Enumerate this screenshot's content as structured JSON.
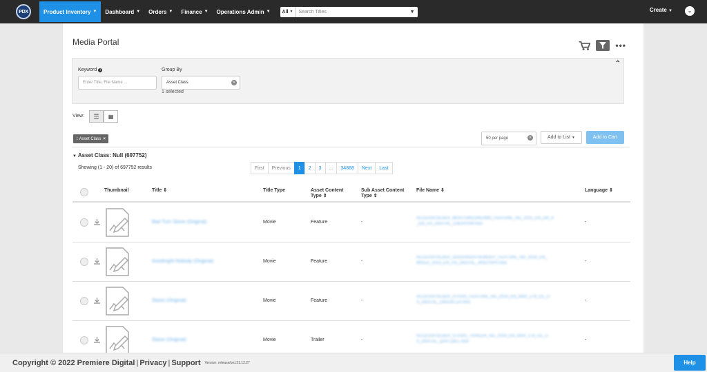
{
  "nav": {
    "logo": "PDX",
    "items": [
      {
        "label": "Product Inventory"
      },
      {
        "label": "Dashboard"
      },
      {
        "label": "Orders"
      },
      {
        "label": "Finance"
      },
      {
        "label": "Operations Admin"
      }
    ],
    "search_scope": "All",
    "search_placeholder": "Search Titles",
    "create_label": "Create"
  },
  "page": {
    "title": "Media Portal",
    "keyword_label": "Keyword",
    "keyword_placeholder": "Enter Title, File Name ...",
    "group_by_label": "Group By",
    "group_by_value": "Asset Class",
    "group_by_selected": "1 selected",
    "view_label": "View:",
    "filter_chip": ":: Asset Class",
    "per_page": "50 per page",
    "add_to_list": "Add to List",
    "add_to_cart": "Add to Cart",
    "group_title": "Asset Class: Null (697752)",
    "showing": "Showing (1 - 20) of 697752 results"
  },
  "pager": [
    "First",
    "Previous",
    "1",
    "2",
    "3",
    "...",
    "34888",
    "Next",
    "Last"
  ],
  "table": {
    "headers": {
      "thumbnail": "Thumbnail",
      "title": "Title",
      "title_type": "Title Type",
      "asset_content_type": "Asset Content Type",
      "sub_asset_content_type": "Sub Asset Content Type",
      "file_name": "File Name",
      "language": "Language"
    },
    "rows": [
      {
        "title": "Bad Turn Stone (Original)",
        "title_type": "Movie",
        "asset_type": "Feature",
        "sub_type": "-",
        "file_line1": "ACCESSFOLDER_MOOTOREDREAMS_FEATURE_HD_2015_EN_DR_6",
        "file_line2": "_EN_US_DIGITAL_12BJ0VXW.mov",
        "language": "-"
      },
      {
        "title": "Goodnight Nobody (Original)",
        "title_type": "Movie",
        "asset_type": "Feature",
        "sub_type": "-",
        "file_line1": "ACCESSFOLDER_GOODNIGHTNOBODY_FEATURE_HD_2019_EN_",
        "file_line2": "MIXED_2013_EN_US_DIGITAL_JKN2YAP0.mov",
        "language": "-"
      },
      {
        "title": "Stasis (Original)",
        "title_type": "Movie",
        "asset_type": "Feature",
        "sub_type": "-",
        "file_line1": "ACCESSFOLDER_STASIS_FEATURE_HD_2019_EN_NAR_178_CE_U",
        "file_line2": "S_DIGITAL_LWDLKFZA.mov",
        "language": "-"
      },
      {
        "title": "Stasis (Original)",
        "title_type": "Movie",
        "asset_type": "Trailer",
        "sub_type": "-",
        "file_line1": "ACCESSFOLDER_STASIS_TRAILER_HD_2019_EN_NAR_178_CE_U",
        "file_line2": "S_DIGITAL_QX4TZ8LL.mov",
        "language": "-"
      }
    ]
  },
  "footer": {
    "copyright": "Copyright © 2022 Premiere Digital",
    "privacy": "Privacy",
    "support": "Support",
    "version": "Version: release/prd.21.12.27",
    "help": "Help"
  }
}
